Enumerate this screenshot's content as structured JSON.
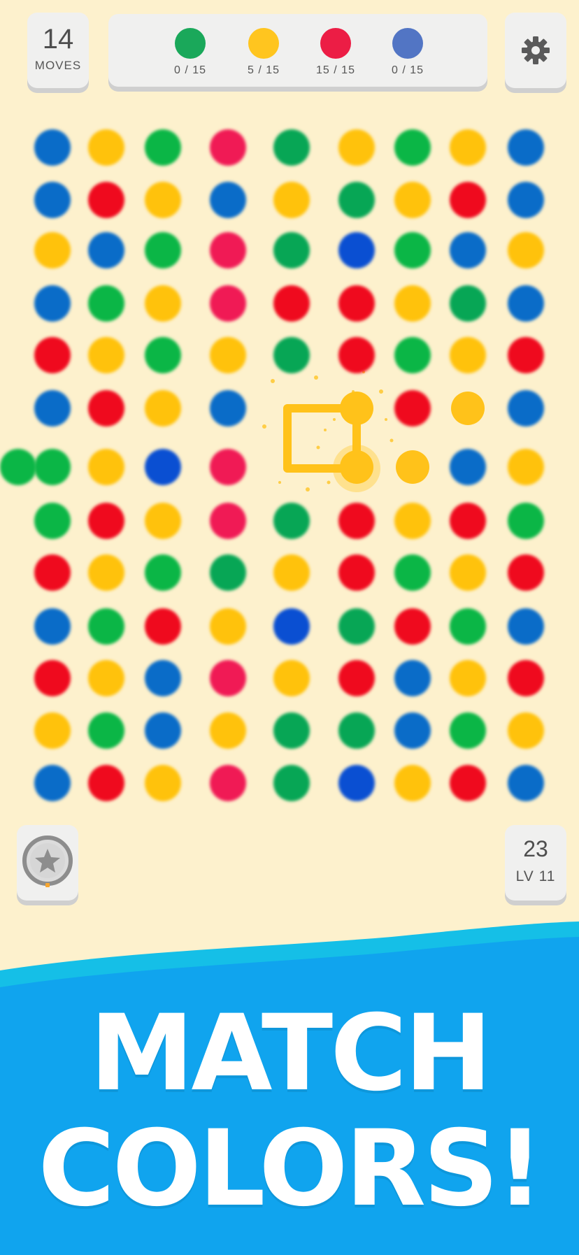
{
  "header": {
    "moves_count": "14",
    "moves_label": "MOVES",
    "goals": [
      {
        "color": "#1aa85a",
        "text": "0 / 15"
      },
      {
        "color": "#ffc51f",
        "text": "5 / 15"
      },
      {
        "color": "#ec1d45",
        "text": "15 / 15"
      },
      {
        "color": "#5275c4",
        "text": "0 / 15"
      }
    ],
    "settings_icon": "gear-icon"
  },
  "colors": {
    "B": "#0a6cc8",
    "b": "#0a4fd2",
    "Y": "#ffc20c",
    "G": "#0bb646",
    "g": "#07a655",
    "P": "#f01a55",
    "R": "#ef0a1e",
    "O": "#ffc21a"
  },
  "board": {
    "rows": [
      "BYGPgYGYB",
      "BRYBYgYRB",
      "YBGPgbGBY",
      "BGYPRRYgB",
      "RYGYgRGYR",
      "BRYB OROB",
      "GYbP OOBYG",
      "GRYPgRYRG",
      "RYGgYRGYR",
      "BGRYbgRGB",
      "RYBPYRBYR",
      "YGBYggBGY",
      "BRYPgbYRB"
    ]
  },
  "footer": {
    "powerup_icon": "star-icon",
    "level_score": "23",
    "level_label": "LV 11"
  },
  "banner": {
    "line1": "MATCH",
    "line2": "COLORS!"
  }
}
